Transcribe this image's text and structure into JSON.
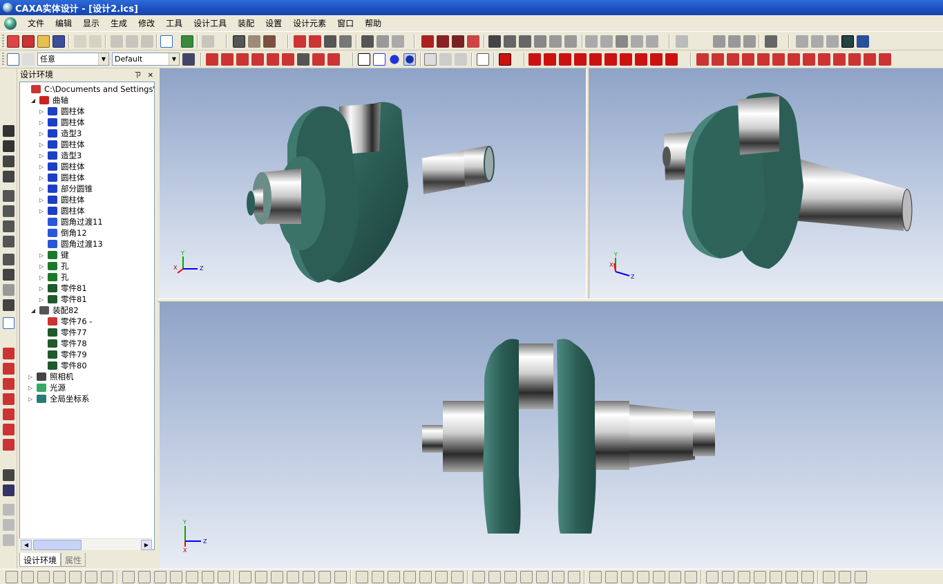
{
  "window": {
    "title": "CAXA实体设计 - [设计2.ics]"
  },
  "menu": [
    "文件",
    "编辑",
    "显示",
    "生成",
    "修改",
    "工具",
    "设计工具",
    "装配",
    "设置",
    "设计元素",
    "窗口",
    "帮助"
  ],
  "toolbar2": {
    "selection_filter": "任意",
    "style_combo": "Default"
  },
  "panel": {
    "title": "设计环境",
    "pin": "ㄗ",
    "close": "✕",
    "tabs": {
      "active": "设计环境",
      "inactive": "属性"
    }
  },
  "tree": [
    {
      "label": "C:\\Documents and Settings\\Admini",
      "icon": "design-root-icon"
    },
    {
      "label": "曲轴",
      "icon": "part-icon"
    },
    {
      "label": "圆柱体",
      "icon": "cylinder-icon"
    },
    {
      "label": "圆柱体",
      "icon": "cylinder-icon"
    },
    {
      "label": "造型3",
      "icon": "shape-icon"
    },
    {
      "label": "圆柱体",
      "icon": "cylinder-icon"
    },
    {
      "label": "造型3",
      "icon": "shape-icon"
    },
    {
      "label": "圆柱体",
      "icon": "cylinder-icon"
    },
    {
      "label": "圆柱体",
      "icon": "cylinder-icon"
    },
    {
      "label": "部分圆锥",
      "icon": "cone-icon"
    },
    {
      "label": "圆柱体",
      "icon": "cylinder-icon"
    },
    {
      "label": "圆柱体",
      "icon": "cylinder-icon"
    },
    {
      "label": "圆角过渡11",
      "icon": "fillet-icon"
    },
    {
      "label": "倒角12",
      "icon": "chamfer-icon"
    },
    {
      "label": "圆角过渡13",
      "icon": "fillet-icon"
    },
    {
      "label": "键",
      "icon": "key-feature-icon"
    },
    {
      "label": "孔",
      "icon": "hole-icon"
    },
    {
      "label": "孔",
      "icon": "hole-icon"
    },
    {
      "label": "零件81",
      "icon": "component-icon"
    },
    {
      "label": "零件81",
      "icon": "component-icon"
    },
    {
      "label": "装配82",
      "icon": "assembly-icon"
    },
    {
      "label": "零件76 -",
      "icon": "component-disabled-icon"
    },
    {
      "label": "零件77",
      "icon": "component-icon"
    },
    {
      "label": "零件78",
      "icon": "component-icon"
    },
    {
      "label": "零件79",
      "icon": "component-icon"
    },
    {
      "label": "零件80",
      "icon": "component-icon"
    },
    {
      "label": "照相机",
      "icon": "camera-icon"
    },
    {
      "label": "光源",
      "icon": "light-icon"
    },
    {
      "label": "全局坐标系",
      "icon": "global-axes-icon"
    }
  ],
  "axes": {
    "x": "X",
    "y": "Y",
    "z": "Z"
  },
  "colors": {
    "title_bar": "#1a4fbf",
    "web_green": "#2c5e56",
    "chrome_light": "#e8e8e8",
    "viewport_top": "#8ea3c7",
    "viewport_bottom": "#e8edf5"
  }
}
